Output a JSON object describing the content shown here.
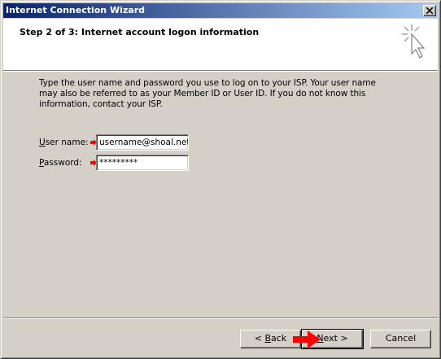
{
  "window": {
    "title": "Internet Connection Wizard"
  },
  "header": {
    "heading": "Step 2 of 3: Internet account logon information",
    "icon": "wizard-cursor-icon"
  },
  "body": {
    "instructions": "Type the user name and password you use to log on to your ISP. Your user name may also be referred to as your Member ID or User ID. If you do not know this information, contact your ISP."
  },
  "form": {
    "username": {
      "label_prefix": "",
      "label_access": "U",
      "label_rest": "ser name:",
      "value": "username@shoal.net.a"
    },
    "password": {
      "label_prefix": "",
      "label_access": "P",
      "label_rest": "assword:",
      "value": "*********"
    }
  },
  "buttons": {
    "back_prefix": "< ",
    "back_access": "B",
    "back_rest": "ack",
    "next_access": "N",
    "next_rest": "ext >",
    "cancel": "Cancel"
  },
  "colors": {
    "titlebar_start": "#0a246a",
    "titlebar_end": "#a6caf0",
    "annotation_arrow": "#ff0000"
  }
}
